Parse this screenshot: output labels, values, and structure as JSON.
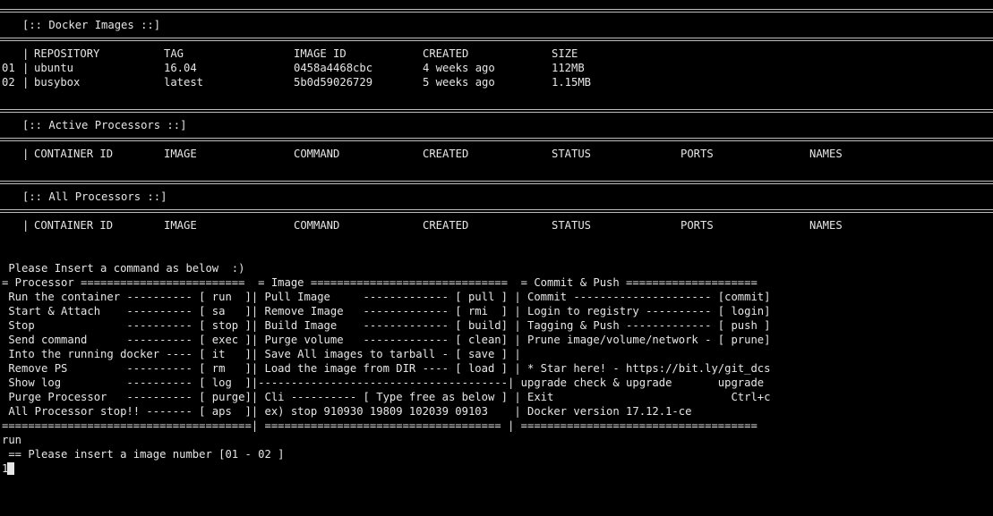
{
  "images_section": {
    "title": "[:: Docker Images ::]",
    "columns": [
      "REPOSITORY",
      "TAG",
      "IMAGE ID",
      "CREATED",
      "SIZE"
    ],
    "rows": [
      {
        "num": "01",
        "repository": "ubuntu",
        "tag": "16.04",
        "image_id": "0458a4468cbc",
        "created": "4 weeks ago",
        "size": "112MB"
      },
      {
        "num": "02",
        "repository": "busybox",
        "tag": "latest",
        "image_id": "5b0d59026729",
        "created": "5 weeks ago",
        "size": "1.15MB"
      }
    ]
  },
  "active_section": {
    "title": "[:: Active Processors ::]",
    "columns": [
      "CONTAINER ID",
      "IMAGE",
      "COMMAND",
      "CREATED",
      "STATUS",
      "PORTS",
      "NAMES"
    ]
  },
  "all_section": {
    "title": "[:: All Processors ::]",
    "columns": [
      "CONTAINER ID",
      "IMAGE",
      "COMMAND",
      "CREATED",
      "STATUS",
      "PORTS",
      "NAMES"
    ]
  },
  "menu": {
    "prompt": " Please Insert a command as below  :)",
    "header": "= Processor =========================  = Image ==============================  = Commit & Push ====================",
    "rows": [
      " Run the container ---------- [ run  ]| Pull Image     ------------- [ pull ] | Commit --------------------- [commit]",
      " Start & Attach    ---------- [ sa   ]| Remove Image   ------------- [ rmi  ] | Login to registry ---------- [ login]",
      " Stop              ---------- [ stop ]| Build Image    ------------- [ build] | Tagging & Push ------------- [ push ]",
      " Send command      ---------- [ exec ]| Purge volume   ------------- [ clean] | Prune image/volume/network - [ prune]",
      " Into the running docker ---- [ it   ]| Save All images to tarball - [ save ] |",
      " Remove PS         ---------- [ rm   ]| Load the image from DIR ---- [ load ] | * Star here! - https://bit.ly/git_dcs",
      " Show log          ---------- [ log  ]|--------------------------------------| upgrade check & upgrade       upgrade",
      " Purge Processor   ---------- [ purge]| Cli ---------- [ Type free as below ] | Exit                           Ctrl+c",
      " All Processor stop!! ------- [ aps  ]| ex) stop 910930 19809 102039 09103    | Docker version 17.12.1-ce"
    ],
    "footer": "======================================| ==================================== | ===================================="
  },
  "session": {
    "command": "run",
    "question": " == Please insert a image number [01 - 02 ]",
    "input_value": "1"
  }
}
